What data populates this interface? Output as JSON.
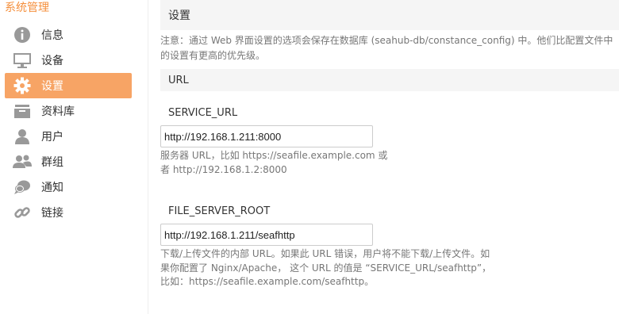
{
  "sidebar": {
    "title": "系统管理",
    "items": [
      {
        "label": "信息",
        "icon": "info-icon",
        "active": false
      },
      {
        "label": "设备",
        "icon": "monitor-icon",
        "active": false
      },
      {
        "label": "设置",
        "icon": "gear-icon",
        "active": true
      },
      {
        "label": "资料库",
        "icon": "library-icon",
        "active": false
      },
      {
        "label": "用户",
        "icon": "user-icon",
        "active": false
      },
      {
        "label": "群组",
        "icon": "group-icon",
        "active": false
      },
      {
        "label": "通知",
        "icon": "notification-icon",
        "active": false
      },
      {
        "label": "链接",
        "icon": "link-icon",
        "active": false
      }
    ]
  },
  "main": {
    "title": "设置",
    "note": "注意：通过 Web 界面设置的选项会保存在数据库 (seahub-db/constance_config) 中。他们比配置文件中的设置有更高的优先级。",
    "section": "URL",
    "fields": [
      {
        "name": "SERVICE_URL",
        "value": "http://192.168.1.211:8000",
        "help": "服务器 URL，比如 https://seafile.example.com 或者 http://192.168.1.2:8000"
      },
      {
        "name": "FILE_SERVER_ROOT",
        "value": "http://192.168.1.211/seafhttp",
        "help": "下载/上传文件的内部 URL。如果此 URL 错误，用户将不能下载/上传文件。如果你配置了 Nginx/Apache， 这个 URL 的值是 “SERVICE_URL/seafhttp”，比如：https://seafile.example.com/seafhttp。"
      }
    ]
  },
  "colors": {
    "accent": "#f58f3c",
    "active_bg": "#f7a465",
    "icon_gray": "#999999"
  }
}
